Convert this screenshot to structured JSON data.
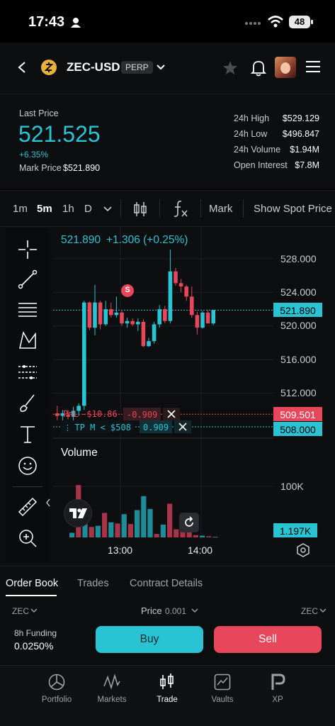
{
  "status_bar": {
    "time": "17:43",
    "battery": "48"
  },
  "header": {
    "pair": "ZEC-USD",
    "badge": "PERP"
  },
  "price": {
    "last_label": "Last Price",
    "last_value": "521.525",
    "change": "+6.35%",
    "mark_label": "Mark Price",
    "mark_value": "$521.890"
  },
  "stats": [
    {
      "label": "24h High",
      "value": "$529.129"
    },
    {
      "label": "24h Low",
      "value": "$496.847"
    },
    {
      "label": "24h Volume",
      "value": "$1.94M"
    },
    {
      "label": "Open Interest",
      "value": "$7.8M"
    }
  ],
  "toolbar": {
    "intervals": [
      "1m",
      "5m",
      "1h",
      "D"
    ],
    "mark": "Mark",
    "show_spot": "Show Spot Price"
  },
  "chart": {
    "legend_price": "521.890",
    "legend_change": "+1.306 (+0.25%)",
    "y_ticks": [
      "528.000",
      "524.000",
      "521.890",
      "520.000",
      "516.000",
      "512.000",
      "509.501",
      "508.000"
    ],
    "volume_label": "Volume",
    "volume_tick": "100K",
    "volume_current": "1.197K",
    "x_ticks": [
      "13:00",
      "14:00"
    ],
    "signal_marker": "S",
    "pnl_line": {
      "label": "PnL",
      "value": "-$10.86",
      "qty": "-0.909"
    },
    "tp_line": {
      "label": "TP M < $508",
      "qty": "0.909"
    },
    "colors": {
      "up": "#2ac3d3",
      "down": "#e8465a"
    }
  },
  "chart_data": {
    "type": "candlestick",
    "x_ticks": [
      "13:00",
      "14:00"
    ],
    "ylim": [
      506,
      530
    ],
    "candles": [
      {
        "o": 509.6,
        "h": 510.5,
        "l": 508.8,
        "c": 509.3
      },
      {
        "o": 509.3,
        "h": 510.0,
        "l": 508.7,
        "c": 509.6
      },
      {
        "o": 509.4,
        "h": 510.0,
        "l": 508.9,
        "c": 509.2
      },
      {
        "o": 509.2,
        "h": 510.4,
        "l": 508.7,
        "c": 509.9
      },
      {
        "o": 509.9,
        "h": 510.8,
        "l": 509.3,
        "c": 510.5
      },
      {
        "o": 510.5,
        "h": 523.0,
        "l": 510.0,
        "c": 522.8
      },
      {
        "o": 522.8,
        "h": 522.9,
        "l": 519.5,
        "c": 519.8
      },
      {
        "o": 519.8,
        "h": 524.9,
        "l": 518.9,
        "c": 522.8
      },
      {
        "o": 522.8,
        "h": 523.0,
        "l": 519.6,
        "c": 520.2
      },
      {
        "o": 520.2,
        "h": 523.0,
        "l": 520.0,
        "c": 522.0
      },
      {
        "o": 522.0,
        "h": 522.8,
        "l": 521.0,
        "c": 521.3
      },
      {
        "o": 521.3,
        "h": 523.5,
        "l": 521.0,
        "c": 521.6
      },
      {
        "o": 521.6,
        "h": 521.8,
        "l": 520.0,
        "c": 520.3
      },
      {
        "o": 520.3,
        "h": 521.0,
        "l": 519.8,
        "c": 520.6
      },
      {
        "o": 520.6,
        "h": 520.9,
        "l": 520.0,
        "c": 520.2
      },
      {
        "o": 520.2,
        "h": 520.9,
        "l": 519.4,
        "c": 520.5
      },
      {
        "o": 520.5,
        "h": 520.8,
        "l": 517.5,
        "c": 517.6
      },
      {
        "o": 517.6,
        "h": 518.6,
        "l": 517.5,
        "c": 518.2
      },
      {
        "o": 518.2,
        "h": 520.5,
        "l": 517.9,
        "c": 520.2
      },
      {
        "o": 520.2,
        "h": 522.5,
        "l": 519.8,
        "c": 522.0
      },
      {
        "o": 522.0,
        "h": 522.4,
        "l": 520.3,
        "c": 520.6
      },
      {
        "o": 520.6,
        "h": 529.1,
        "l": 520.3,
        "c": 526.5
      },
      {
        "o": 526.5,
        "h": 526.9,
        "l": 524.8,
        "c": 525.1
      },
      {
        "o": 525.1,
        "h": 525.6,
        "l": 524.0,
        "c": 524.7
      },
      {
        "o": 524.7,
        "h": 524.9,
        "l": 523.0,
        "c": 523.5
      },
      {
        "o": 523.5,
        "h": 524.7,
        "l": 521.0,
        "c": 521.3
      },
      {
        "o": 521.3,
        "h": 521.7,
        "l": 519.0,
        "c": 519.8
      },
      {
        "o": 519.8,
        "h": 521.8,
        "l": 519.7,
        "c": 521.6
      },
      {
        "o": 521.6,
        "h": 521.9,
        "l": 520.5,
        "c": 520.3
      },
      {
        "o": 520.3,
        "h": 521.9,
        "l": 520.1,
        "c": 521.9
      }
    ],
    "volumes": [
      8,
      90,
      46,
      18,
      20,
      42,
      26,
      24,
      40,
      23,
      47,
      71,
      49,
      6,
      22,
      58,
      14,
      16,
      12,
      4,
      3,
      2,
      1
    ]
  },
  "tabs": [
    "Order Book",
    "Trades",
    "Contract Details"
  ],
  "book": {
    "left_unit": "ZEC",
    "price_label": "Price",
    "price_step": "0.001",
    "right_unit": "ZEC",
    "funding_label": "8h Funding",
    "funding_value": "0.0250%",
    "buy": "Buy",
    "sell": "Sell"
  },
  "nav": [
    {
      "label": "Portfolio",
      "icon": "portfolio-icon"
    },
    {
      "label": "Markets",
      "icon": "markets-icon"
    },
    {
      "label": "Trade",
      "icon": "trade-icon"
    },
    {
      "label": "Vaults",
      "icon": "vaults-icon"
    },
    {
      "label": "XP",
      "icon": "xp-icon"
    }
  ]
}
